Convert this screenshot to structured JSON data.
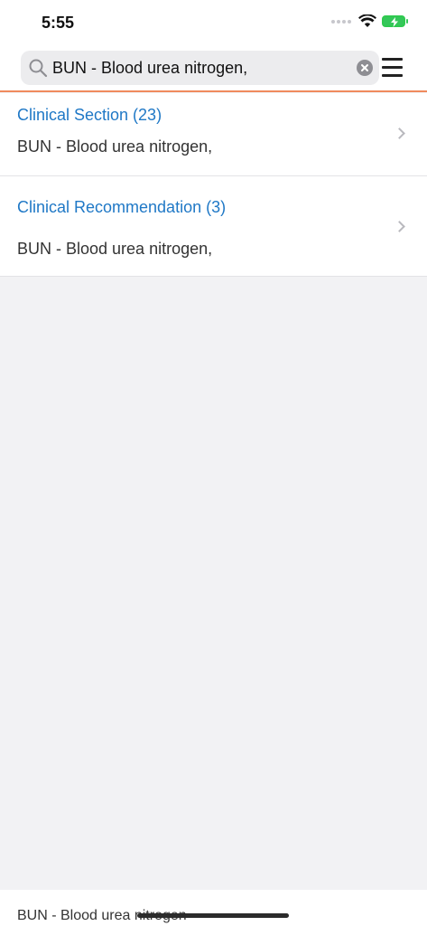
{
  "status_bar": {
    "time": "5:55"
  },
  "search": {
    "value": "BUN - Blood urea nitrogen,"
  },
  "results": [
    {
      "title": "Clinical Section (23)",
      "subtitle": "BUN - Blood urea nitrogen,"
    },
    {
      "title": "Clinical Recommendation (3)",
      "subtitle": "BUN - Blood urea nitrogen,"
    }
  ],
  "bottom": {
    "text": "BUN - Blood urea nitrogen"
  },
  "colors": {
    "accent": "#1f78c6",
    "divider": "#f08a5d",
    "battery": "#34c759"
  },
  "icons": [
    "search-icon",
    "clear-icon",
    "menu-icon",
    "chevron-right-icon",
    "wifi-icon",
    "battery-icon",
    "cellular-icon"
  ]
}
